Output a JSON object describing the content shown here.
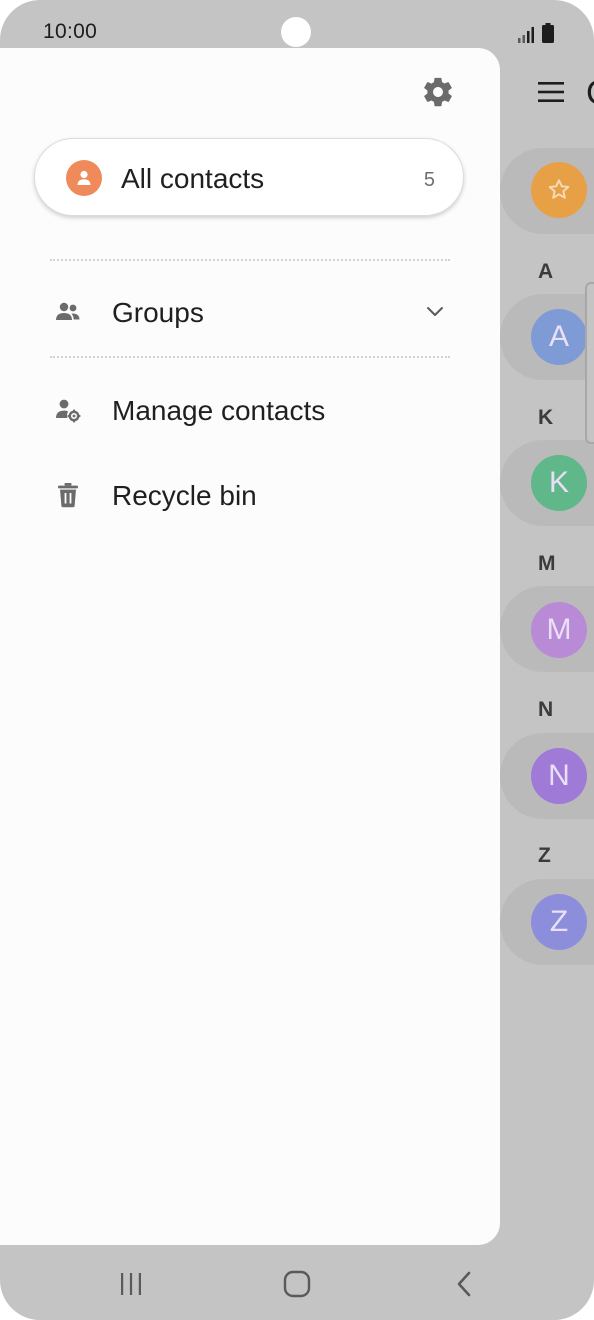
{
  "status_bar": {
    "time": "10:00"
  },
  "drawer": {
    "all_contacts": {
      "label": "All contacts",
      "count": "5",
      "icon": "person-icon",
      "icon_color": "#ef8a5b"
    },
    "items": [
      {
        "label": "Groups",
        "icon": "groups-icon",
        "has_chevron": true
      },
      {
        "label": "Manage contacts",
        "icon": "manage-contacts-icon"
      },
      {
        "label": "Recycle bin",
        "icon": "trash-icon"
      }
    ]
  },
  "background_list": {
    "favorites_icon_color": "#e8a046",
    "sections": [
      {
        "letter": "A",
        "avatar": "A",
        "color": "#7f9bd6"
      },
      {
        "letter": "K",
        "avatar": "K",
        "color": "#5fb78a"
      },
      {
        "letter": "M",
        "avatar": "M",
        "color": "#b98ad6"
      },
      {
        "letter": "N",
        "avatar": "N",
        "color": "#9f7ad6"
      },
      {
        "letter": "Z",
        "avatar": "Z",
        "color": "#8c8edc"
      }
    ]
  },
  "colors": {
    "drawer_bg": "#fcfcfc",
    "scrim": "#c4c4c4",
    "text": "#1f1f1f",
    "icon": "#6b6b6b"
  }
}
